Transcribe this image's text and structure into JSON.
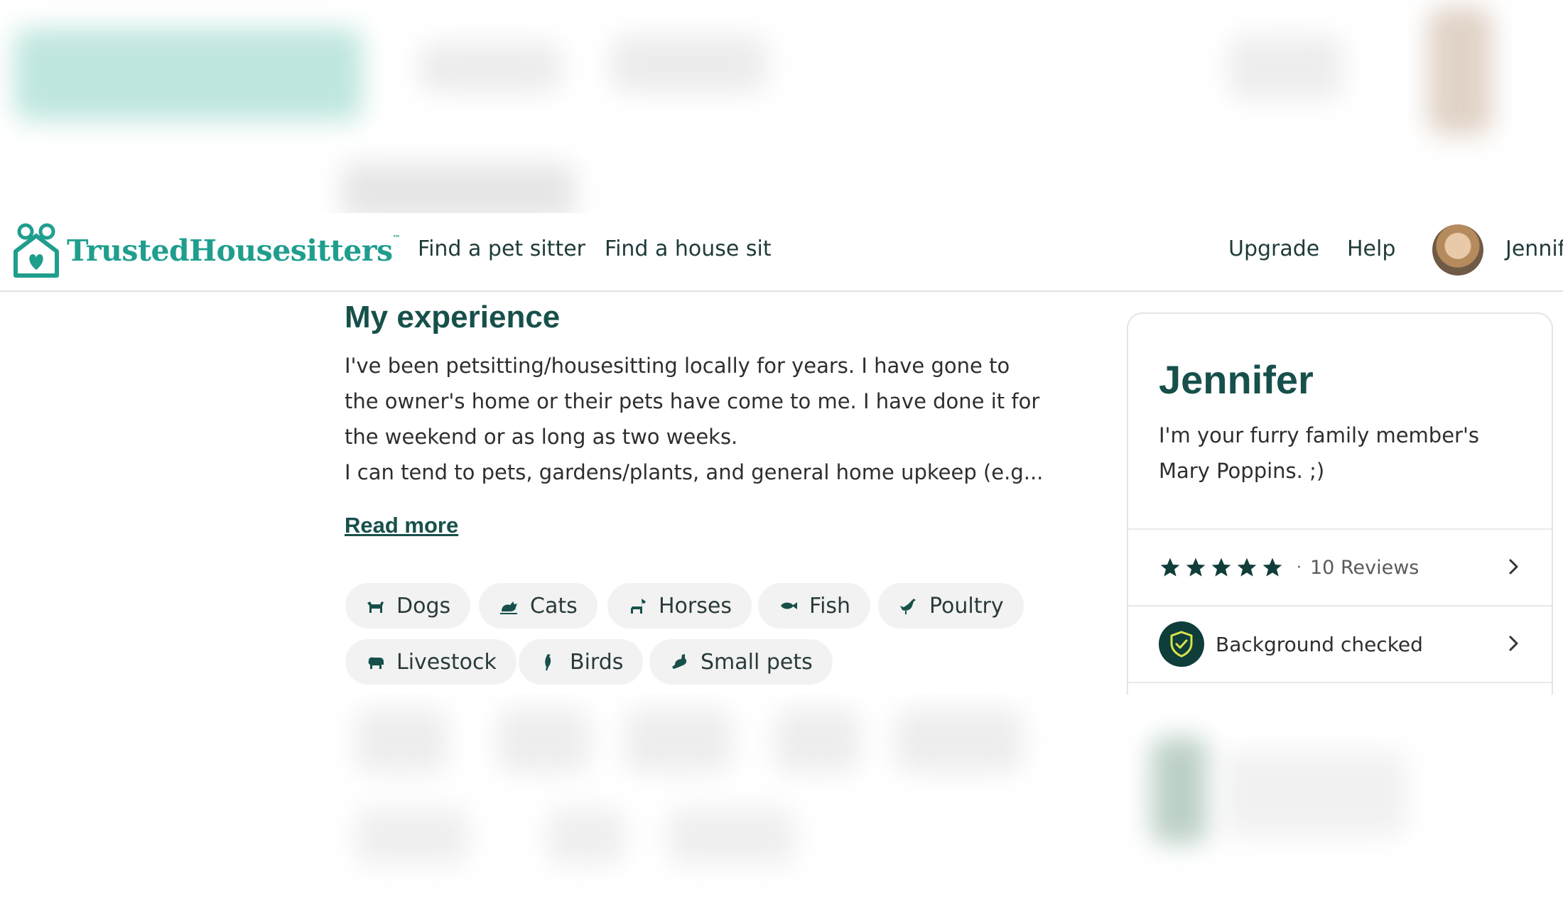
{
  "header": {
    "logo_text": "TrustedHousesitters",
    "logo_tm": "™",
    "nav": {
      "find_pet_sitter": "Find a pet sitter",
      "find_house_sit": "Find a house sit",
      "upgrade": "Upgrade",
      "help": "Help"
    },
    "user_name": "Jennif"
  },
  "experience": {
    "title": "My experience",
    "paragraph_1": "I've been petsitting/housesitting locally for years. I have gone to the owner's home or their pets have come to me. I have done it for the weekend or as long as two weeks.",
    "paragraph_2": "I can tend to pets, gardens/plants, and general home upkeep (e.g...",
    "read_more": "Read more",
    "pets": [
      {
        "label": "Dogs",
        "icon": "dog-icon"
      },
      {
        "label": "Cats",
        "icon": "cat-icon"
      },
      {
        "label": "Horses",
        "icon": "horse-icon"
      },
      {
        "label": "Fish",
        "icon": "fish-icon"
      },
      {
        "label": "Poultry",
        "icon": "poultry-icon"
      },
      {
        "label": "Livestock",
        "icon": "livestock-icon"
      },
      {
        "label": "Birds",
        "icon": "bird-icon"
      },
      {
        "label": "Small pets",
        "icon": "small-pet-icon"
      }
    ]
  },
  "profile_card": {
    "name": "Jennifer",
    "tagline": "I'm your furry family member's Mary Poppins. ;)",
    "rating_stars": 5,
    "rating_max": 5,
    "reviews_label": "10 Reviews",
    "background_label": "Background checked"
  },
  "colors": {
    "brand_teal": "#1f9e8e",
    "heading_green": "#17504b",
    "badge_dark": "#0f3d3a",
    "shield_yellow": "#d7e34b"
  }
}
